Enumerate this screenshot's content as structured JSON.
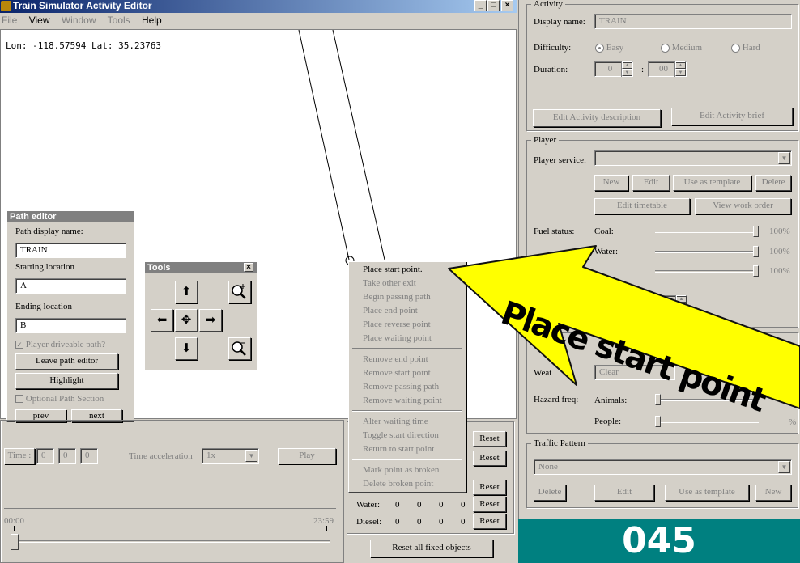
{
  "window": {
    "title": "Train Simulator Activity Editor"
  },
  "menu": [
    "File",
    "View",
    "Window",
    "Tools",
    "Help"
  ],
  "map": {
    "coords": "Lon: -118.57594  Lat: 35.23763"
  },
  "path_editor": {
    "title": "Path editor",
    "display_name_label": "Path display name:",
    "display_name_value": "TRAIN",
    "starting_label": "Starting location",
    "starting_value": "A",
    "ending_label": "Ending location",
    "ending_value": "B",
    "driveable_label": "Player driveable path?",
    "leave_button": "Leave path editor",
    "highlight_button": "Highlight",
    "optional_label": "Optional Path Section",
    "prev_button": "prev",
    "next_button": "next"
  },
  "tools": {
    "title": "Tools",
    "close": "×"
  },
  "context_menu": [
    "Place start point.",
    "Take other exit",
    "Begin passing path",
    "Place end point",
    "Place reverse point",
    "Place waiting point",
    "Remove end point",
    "Remove start point",
    "Remove passing path",
    "Remove waiting point",
    "Alter waiting time",
    "Toggle start direction",
    "Return to start point",
    "Mark point as broken",
    "Delete broken point"
  ],
  "timebar": {
    "time_label": "Time :",
    "h": "0",
    "m": "0",
    "s": "0",
    "accel_label": "Time acceleration",
    "accel_value": "1x",
    "play": "Play",
    "start": "00:00",
    "end": "23:59"
  },
  "resources": {
    "water_label": "Water:",
    "diesel_label": "Diesel:",
    "water_vals": [
      "0",
      "0",
      "0",
      "0"
    ],
    "diesel_vals": [
      "0",
      "0",
      "0",
      "0"
    ],
    "reset": "Reset",
    "reset_all": "Reset all fixed objects"
  },
  "activity": {
    "group": "Activity",
    "display_name_label": "Display name:",
    "display_name_value": "TRAIN",
    "difficulty_label": "Difficulty:",
    "easy": "Easy",
    "medium": "Medium",
    "hard": "Hard",
    "duration_label": "Duration:",
    "dur_h": "0",
    "dur_sep": ":",
    "dur_m": "00",
    "edit_desc": "Edit Activity description",
    "edit_brief": "Edit Activity brief"
  },
  "player": {
    "group": "Player",
    "service_label": "Player service:",
    "new": "New",
    "edit": "Edit",
    "use_template": "Use as template",
    "delete": "Delete",
    "edit_timetable": "Edit timetable",
    "view_work_order": "View work order",
    "fuel_label": "Fuel status:",
    "coal_label": "Coal:",
    "coal_pct": "100%",
    "water_label": "Water:",
    "water_pct": "100%",
    "third_pct": "100%",
    "start_time_m": "00"
  },
  "environment": {
    "weather_label": "Weat",
    "weather_value": "Clear",
    "hazard_label": "Hazard freq:",
    "animals_label": "Animals:",
    "people_label": "People:",
    "people_pct": "%"
  },
  "traffic": {
    "group": "Traffic Pattern",
    "value": "None",
    "delete": "Delete",
    "edit": "Edit",
    "use_template": "Use as template",
    "new": "New"
  },
  "callout": {
    "text": "Place start point",
    "color": "#ffff00"
  },
  "frame_counter": "045"
}
